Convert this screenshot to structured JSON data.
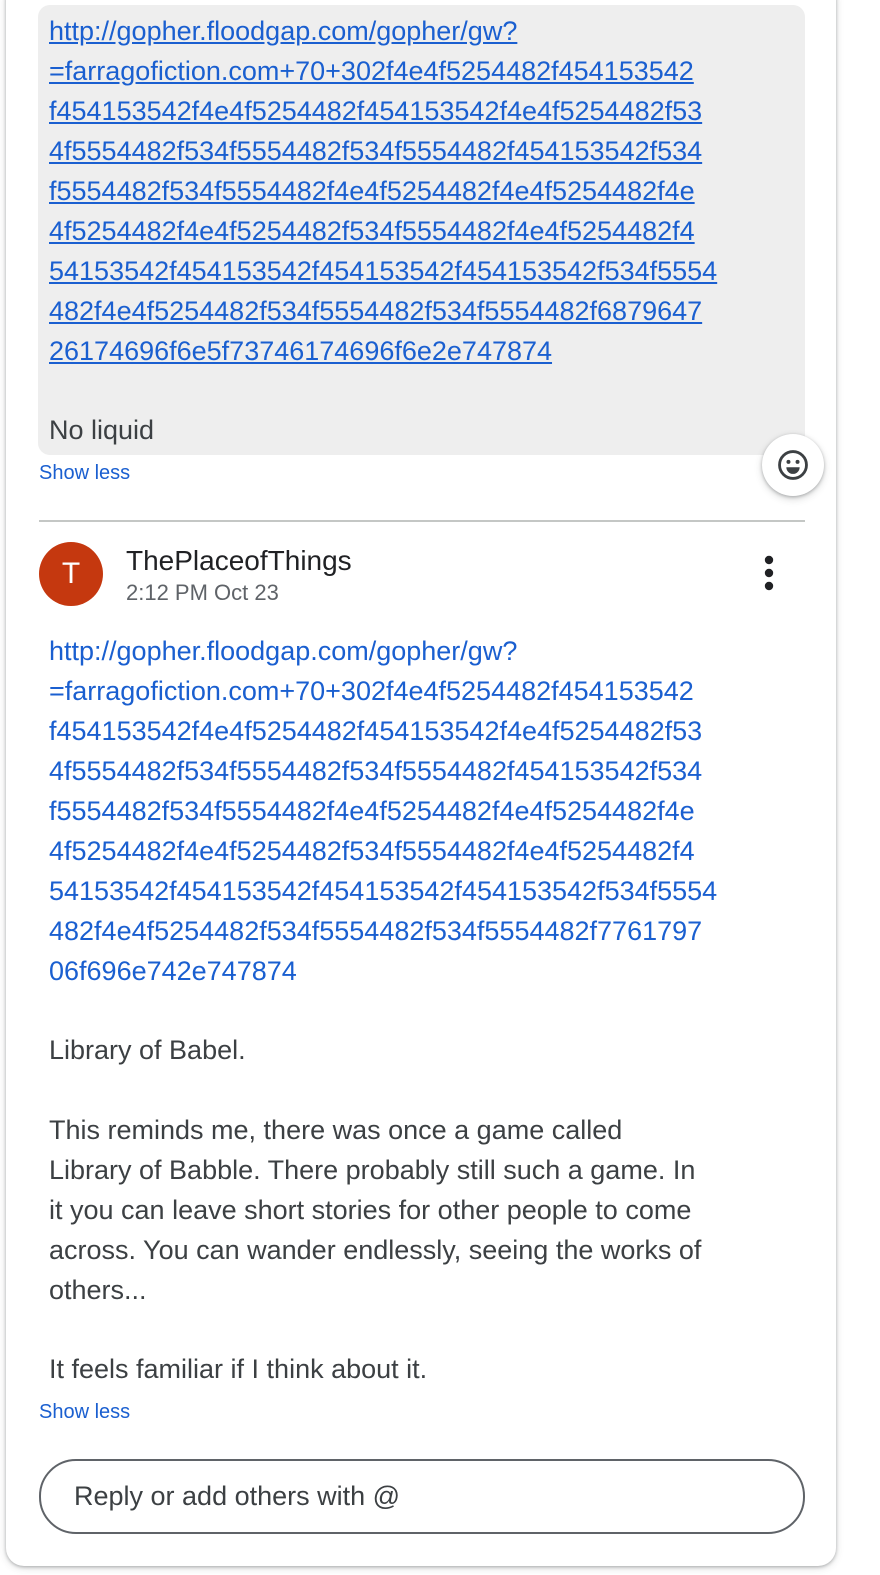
{
  "first_comment": {
    "link_lines": [
      "http://gopher.floodgap.com/gopher/gw?",
      "=farragofiction.com+70+302f4e4f5254482f454153542",
      "f454153542f4e4f5254482f454153542f4e4f5254482f53",
      "4f5554482f534f5554482f534f5554482f454153542f534",
      "f5554482f534f5554482f4e4f5254482f4e4f5254482f4e",
      "4f5254482f4e4f5254482f534f5554482f4e4f5254482f4",
      "54153542f454153542f454153542f454153542f534f5554",
      "482f4e4f5254482f534f5554482f534f5554482f6879647",
      "26174696f6e5f73746174696f6e2e747874"
    ],
    "text": "No liquid",
    "show_less_label": "Show less"
  },
  "reaction": {
    "icon": "smiley-add-reaction-icon"
  },
  "second_comment": {
    "avatar_initial": "T",
    "avatar_color": "#c5380f",
    "author": "ThePlaceofThings",
    "timestamp": "2:12 PM Oct 23",
    "more_icon": "more-vert-icon",
    "link_lines": [
      "http://gopher.floodgap.com/gopher/gw?",
      "=farragofiction.com+70+302f4e4f5254482f454153542",
      "f454153542f4e4f5254482f454153542f4e4f5254482f53",
      "4f5554482f534f5554482f534f5554482f454153542f534",
      "f5554482f534f5554482f4e4f5254482f4e4f5254482f4e",
      "4f5254482f4e4f5254482f534f5554482f4e4f5254482f4",
      "54153542f454153542f454153542f454153542f534f5554",
      "482f4e4f5254482f534f5554482f534f5554482f7761797",
      "06f696e742e747874"
    ],
    "paragraph_1": "Library of Babel.",
    "paragraph_2_lines": [
      "This reminds me, there was once a game called",
      "Library of Babble. There probably still such a game. In",
      "it you can leave short stories for other people to come",
      "across. You can wander endlessly, seeing the works of",
      "others..."
    ],
    "paragraph_3": "It feels familiar if I think about it.",
    "show_less_label": "Show less"
  },
  "reply": {
    "placeholder": "Reply or add others with @"
  },
  "colors": {
    "link": "#1a5fd0",
    "bubble_background": "#eeeeee",
    "text": "#3c4043"
  }
}
